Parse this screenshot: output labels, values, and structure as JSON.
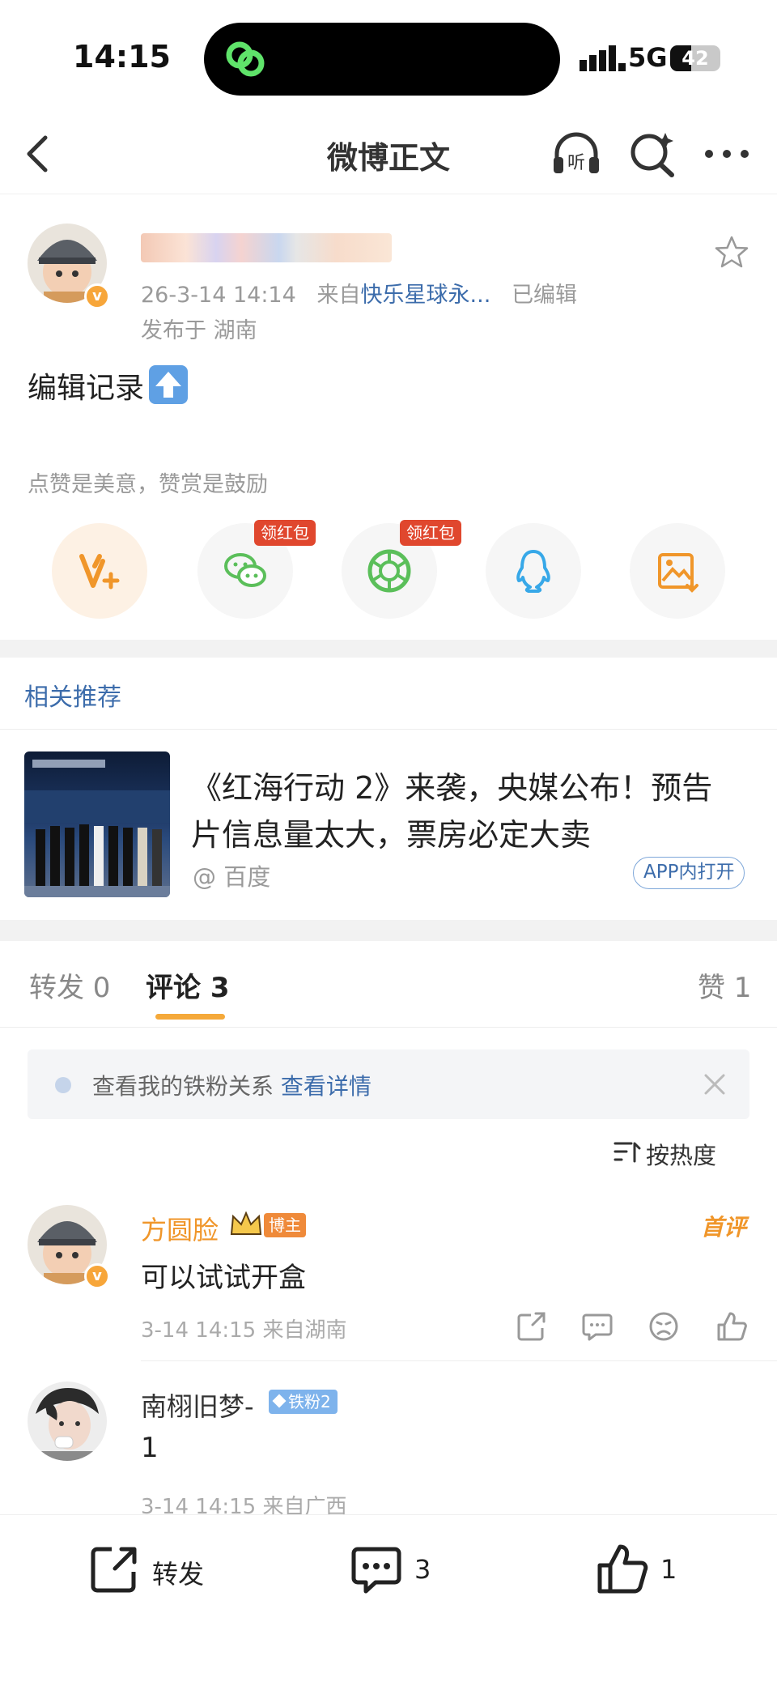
{
  "status_bar": {
    "time": "14:15",
    "network": "5G",
    "battery_level": 42,
    "battery_label": "42"
  },
  "nav": {
    "title": "微博正文"
  },
  "post": {
    "date": "26-3-14 14:14",
    "source_prefix": "来自",
    "source": "快乐星球永...",
    "edited": "已编辑",
    "location": "发布于 湖南",
    "text": "编辑记录",
    "like_hint": "点赞是美意，赞赏是鼓励",
    "share_targets": [
      {
        "name": "vplus",
        "badge": ""
      },
      {
        "name": "wechat",
        "badge": "领红包"
      },
      {
        "name": "moments",
        "badge": "领红包"
      },
      {
        "name": "qq",
        "badge": ""
      },
      {
        "name": "save-image",
        "badge": ""
      }
    ]
  },
  "recommend": {
    "title": "相关推荐",
    "headline": "《红海行动 2》来袭，央媒公布！预告片信息量太大，票房必定大卖",
    "source": "@ 百度",
    "app_open": "APP内打开"
  },
  "tabs": {
    "repost": "转发 0",
    "comment": "评论 3",
    "like": "赞 1"
  },
  "fan_bar": {
    "text": "查看我的铁粉关系",
    "link": "查看详情"
  },
  "sort": {
    "label": "按热度"
  },
  "comments": [
    {
      "name": "方圆脸",
      "tag": "博主",
      "badge": "首评",
      "text": "可以试试开盒",
      "meta": "3-14 14:15  来自湖南"
    },
    {
      "name": "南栩旧梦-",
      "tag": "铁粉2",
      "text": "1",
      "meta": "3-14 14:15  来自广西"
    }
  ],
  "bottom_bar": {
    "repost": "转发",
    "comment_count": "3",
    "like_count": "1"
  },
  "colors": {
    "accent": "#f5a93a",
    "link": "#3c6cab",
    "red": "#e0472e",
    "wechat_green": "#5bbf5a",
    "qq_blue": "#37a8e8"
  }
}
